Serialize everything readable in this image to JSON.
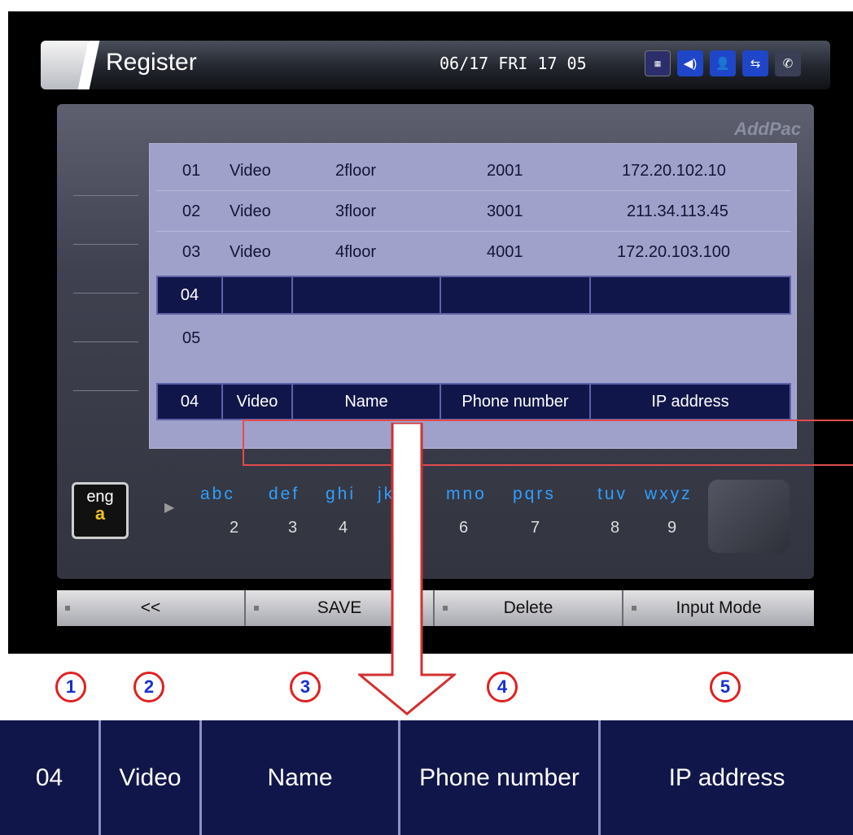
{
  "titlebar": {
    "title": "Register",
    "datetime": "06/17 FRI 17 05"
  },
  "icons": [
    "calendar-icon",
    "speaker-icon",
    "user-icon",
    "network-icon",
    "phone-icon"
  ],
  "brand": "AddPac",
  "entries": [
    {
      "no": "01",
      "type": "Video",
      "name": "2floor",
      "phone": "2001",
      "ip": "172.20.102.10"
    },
    {
      "no": "02",
      "type": "Video",
      "name": "3floor",
      "phone": "3001",
      "ip": "211.34.113.45"
    },
    {
      "no": "03",
      "type": "Video",
      "name": "4floor",
      "phone": "4001",
      "ip": "172.20.103.100"
    }
  ],
  "selected_row": {
    "no": "04"
  },
  "empty_row": {
    "no": "05"
  },
  "edit_row": {
    "no": "04",
    "type": "Video",
    "name": "Name",
    "phone": "Phone number",
    "ip": "IP address"
  },
  "input_mode": {
    "lang": "eng",
    "case": "a"
  },
  "keypad": [
    {
      "letters": "abc",
      "digit": "2"
    },
    {
      "letters": "def",
      "digit": "3"
    },
    {
      "letters": "ghi",
      "digit": "4"
    },
    {
      "letters": "jkl",
      "digit": "5"
    },
    {
      "letters": "mno",
      "digit": "6"
    },
    {
      "letters": "pqrs",
      "digit": "7"
    },
    {
      "letters": "tuv",
      "digit": "8"
    },
    {
      "letters": "wxyz",
      "digit": "9"
    }
  ],
  "function_keys": [
    "<<",
    "SAVE",
    "Delete",
    "Input Mode"
  ],
  "callouts": [
    "1",
    "2",
    "3",
    "4",
    "5"
  ],
  "field_strip": {
    "no": "04",
    "type": "Video",
    "name": "Name",
    "phone": "Phone number",
    "ip": "IP address"
  }
}
